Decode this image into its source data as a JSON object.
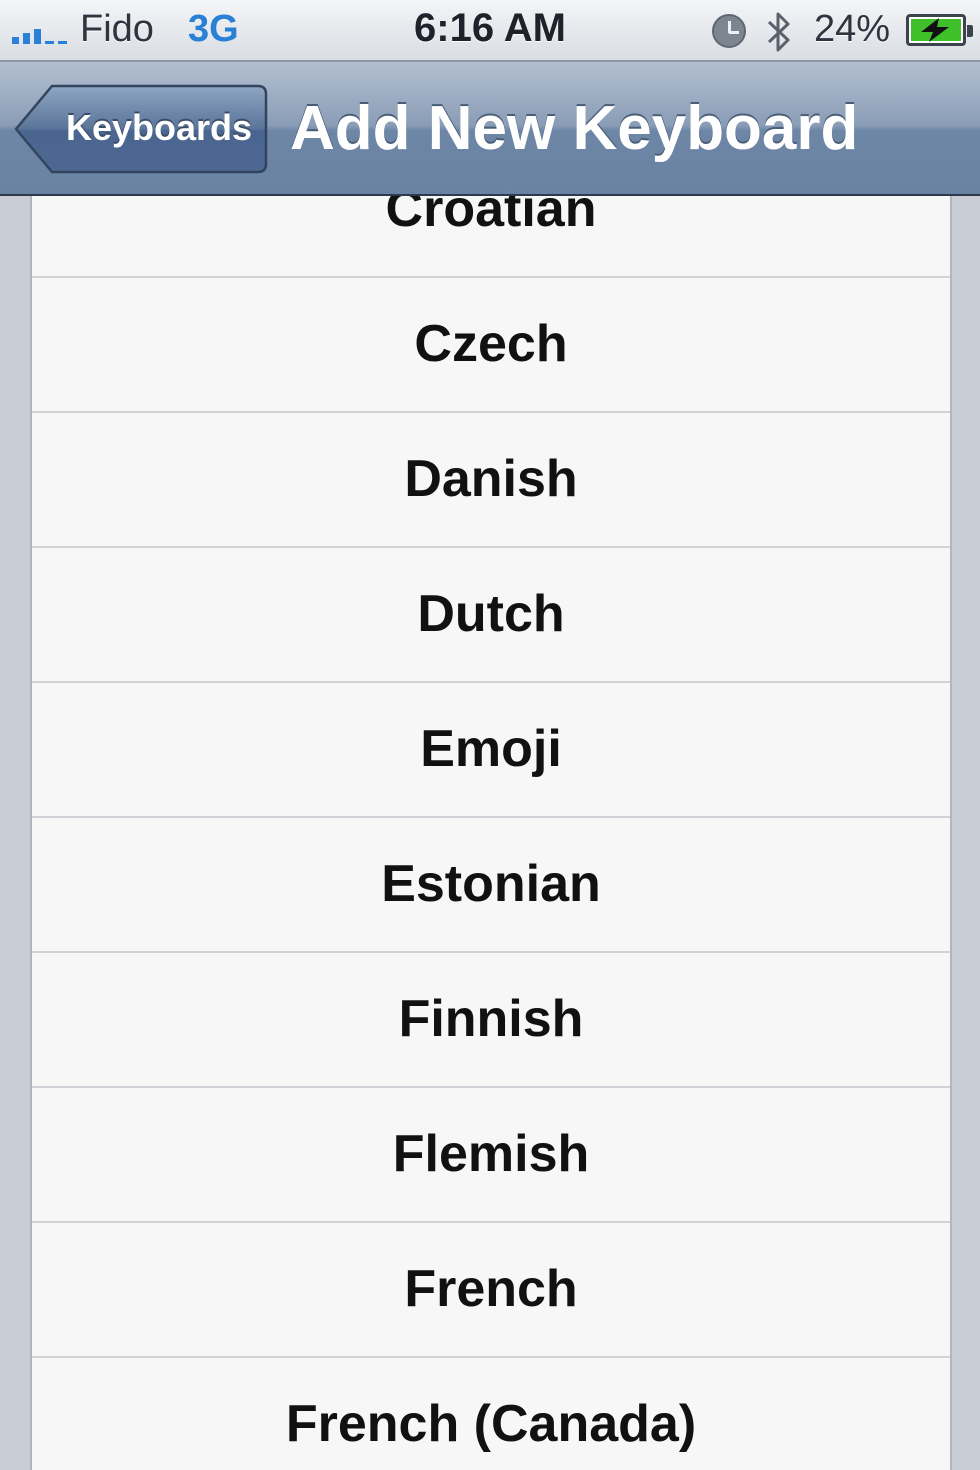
{
  "status_bar": {
    "carrier": "Fido",
    "network": "3G",
    "time": "6:16 AM",
    "battery_percent": "24%",
    "battery_level": 0.24,
    "icons": [
      "signal-icon",
      "clock-icon",
      "bluetooth-icon",
      "battery-charging-icon"
    ]
  },
  "nav_bar": {
    "back_label": "Keyboards",
    "title": "Add New Keyboard"
  },
  "keyboards": [
    "Croatian",
    "Czech",
    "Danish",
    "Dutch",
    "Emoji",
    "Estonian",
    "Finnish",
    "Flemish",
    "French",
    "French (Canada)"
  ],
  "colors": {
    "accent_blue": "#2a7fd6",
    "nav_bar": "#6d86a6",
    "battery_green": "#3fbf2a"
  }
}
